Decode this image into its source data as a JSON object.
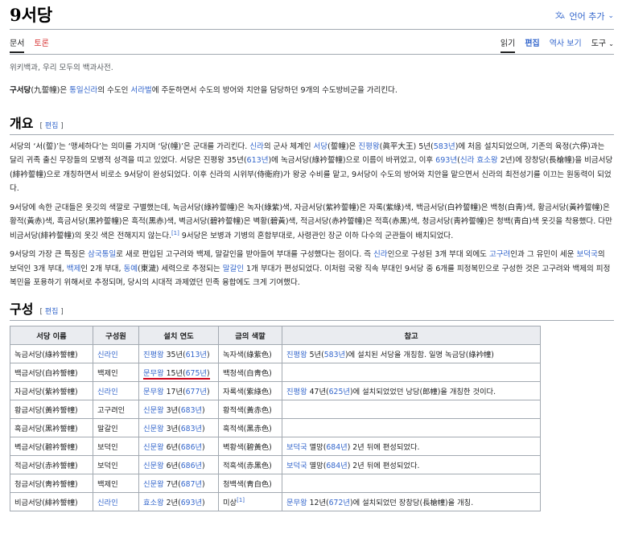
{
  "header": {
    "title": "9서당",
    "lang_button": "언어 추가",
    "lang_icon": "translate-icon"
  },
  "tabs": {
    "left": [
      "문서",
      "토론"
    ],
    "right": [
      "읽기",
      "편집",
      "역사 보기",
      "도구"
    ]
  },
  "sitesub": "위키백과, 우리 모두의 백과사전.",
  "intro": {
    "bold": "구서당",
    "bold_hanja": "(九誓幢)",
    "t1": "은 ",
    "l1": "통일신라",
    "t2": "의 수도인 ",
    "l2": "서라벌",
    "t3": "에 주둔하면서 수도의 방어와 치안을 담당하던 9개의 수도방비군을 가리킨다."
  },
  "sections": {
    "overview_heading": "개요",
    "composition_heading": "구성",
    "edit_label": "편집"
  },
  "overview": {
    "p1": [
      {
        "t": "서당의 ‘서(誓)’는 ‘맹세하다’는 의미를 가지며 ‘당(幢)’은 군대를 가리킨다. "
      },
      {
        "l": "신라"
      },
      {
        "t": "의 군사 체계인 "
      },
      {
        "l": "서당"
      },
      {
        "t": "(誓幢)은 "
      },
      {
        "l": "진평왕"
      },
      {
        "t": "(眞平大王) 5년("
      },
      {
        "l": "583년"
      },
      {
        "t": ")에 처음 설치되었으며, 기존의 육정(六停)과는 달리 귀족 출신 무장들의 모병적 성격을 띠고 있었다. 서당은 진평왕 35년("
      },
      {
        "l": "613년"
      },
      {
        "t": ")에 녹금서당(綠衿誓幢)으로 이름이 바뀌었고, 이후 "
      },
      {
        "l": "693년"
      },
      {
        "t": "("
      },
      {
        "l": "신라 효소왕"
      },
      {
        "t": " 2년)에 장창당(長槍幢)을 비금서당(緋衿誓幢)으로 개칭하면서 비로소 9서당이 완성되었다. 이후 신라의 시위부(侍衛府)가 왕궁 수비를 맡고, 9서당이 수도의 방어와 치안을 맡으면서 신라의 최전성기를 이끄는 원동력이 되었다."
      }
    ],
    "p2": [
      {
        "t": "9서당에 속한 군대들은 옷깃의 색깔로 구별했는데, 녹금서당(綠衿誓幢)은 녹자(綠紫)색, 자금서당(紫衿誓幢)은 자록(紫綠)색, 백금서당(白衿誓幢)은 백청(白靑)색, 황금서당(黃衿誓幢)은 황적(黃赤)색, 흑금서당(黑衿誓幢)은 흑적(黑赤)색, 벽금서당(碧衿誓幢)은 벽황(碧黃)색, 적금서당(赤衿誓幢)은 적흑(赤黑)색, 청금서당(靑衿誓幢)은 청백(靑白)색 옷깃을 착용했다. 다만 비금서당(緋衿誓幢)의 옷깃 색은 전해지지 않는다."
      },
      {
        "s": "[1]"
      },
      {
        "t": " 9서당은 보병과 기병의 혼합부대로, 사령관인 장군 이하 다수의 군관들이 배치되었다."
      }
    ],
    "p3": [
      {
        "t": "9서당의 가장 큰 특징은 "
      },
      {
        "l": "삼국통일"
      },
      {
        "t": "로 새로 편입된 고구려와 백제, 말갈인을 받아들여 부대를 구성했다는 점이다. 즉 "
      },
      {
        "l": "신라"
      },
      {
        "t": "인으로 구성된 3개 부대 외에도 "
      },
      {
        "l": "고구려"
      },
      {
        "t": "인과 그 유민이 세운 "
      },
      {
        "l": "보덕국"
      },
      {
        "t": "의 보덕인 3개 부대, "
      },
      {
        "l": "백제"
      },
      {
        "t": "인 2개 부대, "
      },
      {
        "l": "동예"
      },
      {
        "t": "(東濊) 세력으로 추정되는 "
      },
      {
        "l": "말갈인"
      },
      {
        "t": " 1개 부대가 편성되었다. 이처럼 국왕 직속 부대인 9서당 중 6개를 피정복민으로 구성한 것은 고구려와 백제의 피정복민을 포용하기 위해서로 추정되며, 당시의 시대적 과제였던 민족 융합에도 크게 기여했다."
      }
    ]
  },
  "table": {
    "headers": [
      "서당 이름",
      "구성원",
      "설치 연도",
      "금의 색깔",
      "참고"
    ],
    "rows": [
      {
        "name": "녹금서당(綠衿誓幢)",
        "member": "신라인",
        "member_link": true,
        "king": "진평왕",
        "year_a": " 35년(",
        "year": "613년",
        "year_b": ")",
        "color": "녹자색(綠紫色)",
        "note": [
          {
            "l": "진평왕"
          },
          {
            "t": " 5년("
          },
          {
            "l": "583년"
          },
          {
            "t": ")에 설치된 서당을 개칭함. 일명 녹금당(綠衿幢)"
          }
        ]
      },
      {
        "name": "백금서당(白衿誓幢)",
        "member": "백제인",
        "member_link": false,
        "king": "문무왕",
        "year_a": " 15년(",
        "year": "675년",
        "year_b": ")",
        "color": "백청색(白靑色)",
        "note": [],
        "highlight": true
      },
      {
        "name": "자금서당(紫衿誓幢)",
        "member": "신라인",
        "member_link": true,
        "king": "문무왕",
        "year_a": " 17년(",
        "year": "677년",
        "year_b": ")",
        "color": "자록색(紫綠色)",
        "note": [
          {
            "l": "진평왕"
          },
          {
            "t": " 47년("
          },
          {
            "l": "625년"
          },
          {
            "t": ")에 설치되었었던 낭당(郎幢)을 개칭한 것이다."
          }
        ]
      },
      {
        "name": "황금서당(黃衿誓幢)",
        "member": "고구려인",
        "member_link": false,
        "king": "신문왕",
        "year_a": " 3년(",
        "year": "683년",
        "year_b": ")",
        "color": "황적색(黃赤色)",
        "note": []
      },
      {
        "name": "흑금서당(黑衿誓幢)",
        "member": "말갈인",
        "member_link": false,
        "king": "신문왕",
        "year_a": " 3년(",
        "year": "683년",
        "year_b": ")",
        "color": "흑적색(黑赤色)",
        "note": []
      },
      {
        "name": "벽금서당(碧衿誓幢)",
        "member": "보덕인",
        "member_link": false,
        "king": "신문왕",
        "year_a": " 6년(",
        "year": "686년",
        "year_b": ")",
        "color": "벽황색(碧黃色)",
        "note": [
          {
            "l": "보덕국"
          },
          {
            "t": " 멸망("
          },
          {
            "l": "684년"
          },
          {
            "t": ") 2년 뒤에 편성되었다."
          }
        ]
      },
      {
        "name": "적금서당(赤衿誓幢)",
        "member": "보덕인",
        "member_link": false,
        "king": "신문왕",
        "year_a": " 6년(",
        "year": "686년",
        "year_b": ")",
        "color": "적흑색(赤黑色)",
        "note": [
          {
            "l": "보덕국"
          },
          {
            "t": " 멸망("
          },
          {
            "l": "684년"
          },
          {
            "t": ") 2년 뒤에 편성되었다."
          }
        ]
      },
      {
        "name": "청금서당(靑衿誓幢)",
        "member": "백제인",
        "member_link": false,
        "king": "신문왕",
        "year_a": " 7년(",
        "year": "687년",
        "year_b": ")",
        "color": "청백색(靑白色)",
        "note": []
      },
      {
        "name": "비금서당(緋衿誓幢)",
        "member": "신라인",
        "member_link": true,
        "king": "효소왕",
        "year_a": " 2년(",
        "year": "693년",
        "year_b": ")",
        "color": "미상",
        "color_sup": "[1]",
        "note": [
          {
            "l": "문무왕"
          },
          {
            "t": " 12년("
          },
          {
            "l": "672년"
          },
          {
            "t": ")에 설치되었던 장창당(長槍幢)을 개칭."
          }
        ]
      }
    ]
  }
}
